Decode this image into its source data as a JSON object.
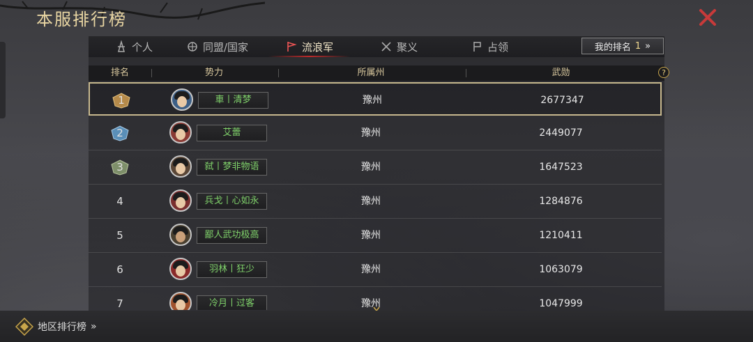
{
  "title": "本服排行榜",
  "tabs": [
    {
      "label": "个人",
      "icon": "tower-icon",
      "active": false
    },
    {
      "label": "同盟/国家",
      "icon": "alliance-helmet-icon",
      "active": false
    },
    {
      "label": "流浪军",
      "icon": "wanderer-flag-icon",
      "active": true
    },
    {
      "label": "聚义",
      "icon": "crossed-swords-icon",
      "active": false
    },
    {
      "label": "占领",
      "icon": "banner-icon",
      "active": false
    }
  ],
  "my_rank": {
    "label": "我的排名",
    "value": "1",
    "arrow": "»"
  },
  "columns": {
    "rank": "排名",
    "faction": "势力",
    "province": "所属州",
    "merit": "武勋"
  },
  "help": "?",
  "rows": [
    {
      "rank": "1",
      "name": "車丨清梦",
      "province": "豫州",
      "merit": "2677347"
    },
    {
      "rank": "2",
      "name": "艾蕾",
      "province": "豫州",
      "merit": "2449077"
    },
    {
      "rank": "3",
      "name": "弑丨梦非物语",
      "province": "豫州",
      "merit": "1647523"
    },
    {
      "rank": "4",
      "name": "兵戈丨心如永",
      "province": "豫州",
      "merit": "1284876"
    },
    {
      "rank": "5",
      "name": "鄙人武功极高",
      "province": "豫州",
      "merit": "1210411"
    },
    {
      "rank": "6",
      "name": "羽林丨狂少",
      "province": "豫州",
      "merit": "1063079"
    },
    {
      "rank": "7",
      "name": "冷月丨过客",
      "province": "豫州",
      "merit": "1047999"
    }
  ],
  "medal_colors": {
    "gold": "#b58a4a",
    "silver": "#5a8fb8",
    "bronze": "#7e8f6a"
  },
  "name_color": "#7fd16a",
  "footer": {
    "label": "地区排行榜",
    "arrow": "»"
  }
}
